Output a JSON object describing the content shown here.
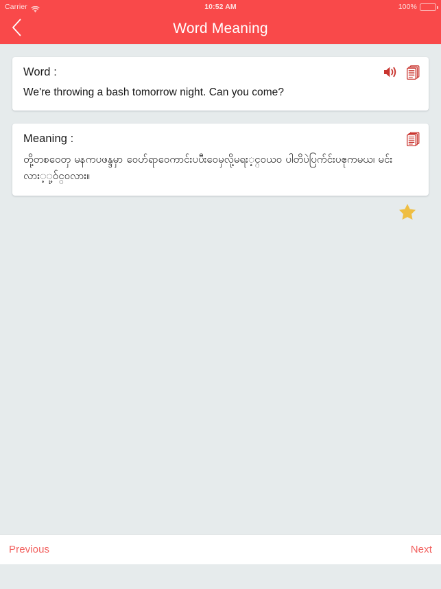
{
  "status_bar": {
    "carrier": "Carrier",
    "wifi_icon": "wifi-icon",
    "time": "10:52 AM",
    "battery_percent": "100%",
    "battery_icon": "battery-icon"
  },
  "nav_bar": {
    "back_icon": "chevron-left-icon",
    "title": "Word Meaning",
    "background_color": "#F9494A"
  },
  "word_card": {
    "label": "Word :",
    "text": "We're throwing a bash tomorrow night. Can you come?",
    "speaker_icon": "speaker-icon",
    "copy_icon": "copy-icon",
    "icon_color": "#C9352F"
  },
  "meaning_card": {
    "label": "Meaning :",
    "text": "တို့တစဝေတှ မနကပဖန္ဒမှာ ဝေဟ်ရာဝေကာင်းပပီးဝေမှလို့မရး့င္ဝယဝ ပါတိပဲပြက်င်းပဧုကမယ၊ မင်းလား့ု့ဝ်င္ဝလား။",
    "copy_icon": "copy-icon",
    "icon_color": "#C9352F"
  },
  "favorite": {
    "icon": "star-icon",
    "color": "#EFBE42",
    "state": "filled"
  },
  "bottom_toolbar": {
    "previous_label": "Previous",
    "next_label": "Next",
    "text_color": "#F2615F"
  },
  "theme": {
    "page_background": "#E6EBEC",
    "card_background": "#FFFFFF",
    "accent": "#F9494A"
  }
}
